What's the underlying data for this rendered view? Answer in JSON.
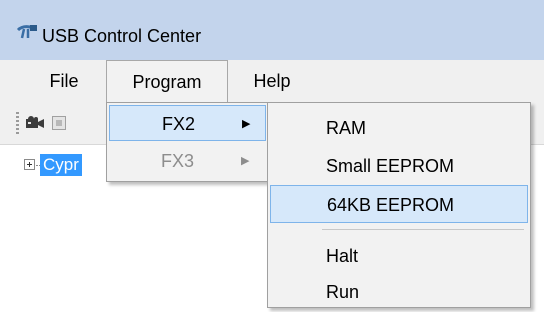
{
  "window": {
    "title": "USB Control Center",
    "icon": "usb-cable-icon"
  },
  "menubar": {
    "file": "File",
    "program": "Program",
    "help": "Help"
  },
  "toolbar": {
    "icons": [
      "camera-icon",
      "stop-icon"
    ]
  },
  "tree": {
    "root_label": "Cypr",
    "expander": "plus-icon",
    "selection_color": "#3399ff"
  },
  "program_menu": {
    "items": [
      {
        "label": "FX2",
        "arrow": "▶",
        "state": "highlighted"
      },
      {
        "label": "FX3",
        "arrow": "▶",
        "state": "disabled"
      }
    ]
  },
  "fx2_submenu": {
    "items": [
      {
        "label": "RAM"
      },
      {
        "label": "Small EEPROM"
      },
      {
        "label": "64KB EEPROM",
        "state": "highlighted"
      },
      {
        "label": "Halt"
      },
      {
        "label": "Run"
      }
    ]
  },
  "colors": {
    "titlebar": "#c3d4ec",
    "menu_bg": "#f2f2f2",
    "highlight": "#d6e8fa",
    "highlight_border": "#7eb4ea",
    "disabled_text": "#8d8d8d"
  }
}
